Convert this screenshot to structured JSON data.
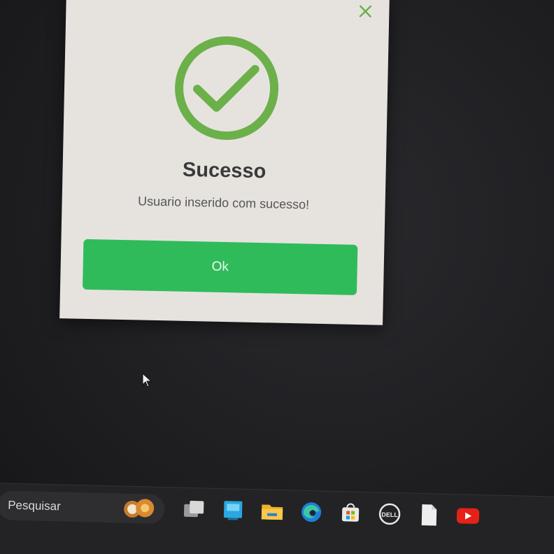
{
  "dialog": {
    "title": "Sucesso",
    "message": "Usuario inserido com sucesso!",
    "ok_label": "Ok",
    "accent_color": "#6cb04a",
    "button_color": "#2fbb5a",
    "icon": "check-circle-icon"
  },
  "taskbar": {
    "search_label": "Pesquisar",
    "icons": [
      "task-view-icon",
      "widgets-icon",
      "file-explorer-icon",
      "edge-icon",
      "store-icon",
      "dell-icon",
      "document-icon",
      "youtube-icon"
    ]
  },
  "dell_label": "DELL"
}
